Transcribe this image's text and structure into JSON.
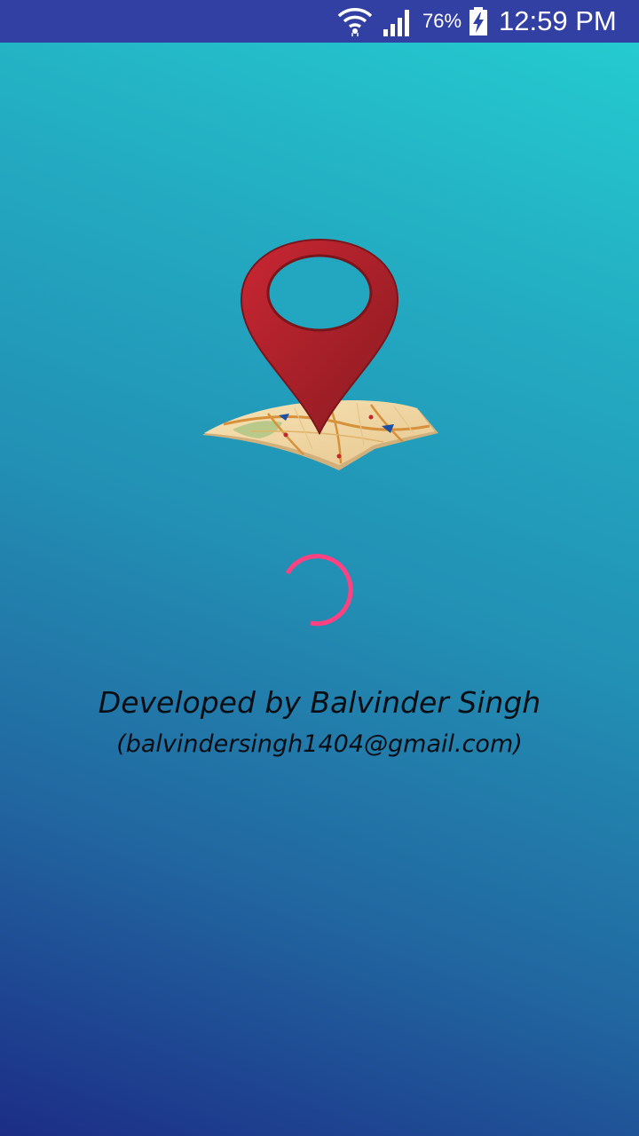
{
  "status_bar": {
    "battery_percent": "76%",
    "time": "12:59 PM",
    "icons": [
      "wifi-icon",
      "signal-icon",
      "battery-charging-icon"
    ]
  },
  "splash": {
    "logo_icon": "map-location-pin-icon",
    "spinner_color": "#ff4081",
    "developer_line": "Developed by Balvinder Singh",
    "email_line": "(balvindersingh1404@gmail.com)"
  },
  "colors": {
    "status_bar": "#3340a3",
    "gradient_top": "#24cfd1",
    "gradient_bottom": "#1c2d86",
    "pin_red": "#b0202a",
    "text": "#0a0d14"
  }
}
